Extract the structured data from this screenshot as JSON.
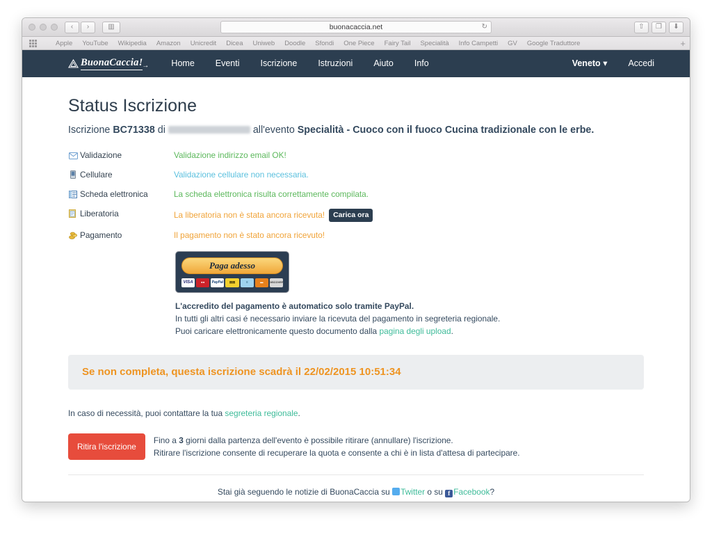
{
  "browser": {
    "url": "buonacaccia.net",
    "reload_icon": "reload-icon",
    "back_icon": "‹",
    "forward_icon": "›",
    "sidebar_icon": "▥",
    "share_icon": "⇧",
    "tabs_icon": "❐",
    "download_icon": "⬇",
    "add_bookmark": "+",
    "bookmarks": [
      "Apple",
      "YouTube",
      "Wikipedia",
      "Amazon",
      "Unicredit",
      "Dicea",
      "Uniweb",
      "Doodle",
      "Sfondi",
      "One Piece",
      "Fairy Tail",
      "Specialità",
      "Info Campetti",
      "GV",
      "Google Traduttore"
    ]
  },
  "site": {
    "logo_text": "BuonaCaccia!",
    "nav": [
      "Home",
      "Eventi",
      "Iscrizione",
      "Istruzioni",
      "Aiuto",
      "Info"
    ],
    "region_selector": "Veneto",
    "region_caret": "▾",
    "login": "Accedi"
  },
  "page": {
    "title": "Status Iscrizione",
    "lead": {
      "prefix": "Iscrizione ",
      "code": "BC71338",
      "of": " di ",
      "name_redacted": "",
      "event_prefix": " all'evento ",
      "event": "Specialità - Cuoco con il fuoco Cucina tradizionale con le erbe."
    },
    "status_rows": [
      {
        "icon": "envelope-icon",
        "label": "Validazione",
        "message": "Validazione indirizzo email OK!",
        "state": "ok"
      },
      {
        "icon": "mobile-phone-icon",
        "label": "Cellulare",
        "message": "Validazione cellulare non necessaria.",
        "state": "info"
      },
      {
        "icon": "form-card-icon",
        "label": "Scheda elettronica",
        "message": "La scheda elettronica risulta correttamente compilata.",
        "state": "ok"
      },
      {
        "icon": "document-icon",
        "label": "Liberatoria",
        "message": "La liberatoria non è stata ancora ricevuta!",
        "state": "warn",
        "action_label": "Carica ora"
      },
      {
        "icon": "coins-icon",
        "label": "Pagamento",
        "message": "Il pagamento non è stato ancora ricevuto!",
        "state": "warn"
      }
    ],
    "paypal": {
      "button_label": "Paga adesso",
      "cards": [
        "VISA",
        "MC",
        "PayPal",
        "JCB",
        "AE",
        "AMEX",
        "DISCOVER"
      ]
    },
    "payment_note": {
      "line1": "L'accredito del pagamento è automatico solo tramite PayPal.",
      "line2": "In tutti gli altri casi é necessario inviare la ricevuta del pagamento in segreteria regionale.",
      "line3_prefix": "Puoi caricare elettronicamente questo documento dalla ",
      "line3_link": "pagina degli upload",
      "line3_suffix": "."
    },
    "expiry_alert": "Se non completa, questa iscrizione scadrà il 22/02/2015 10:51:34",
    "contact": {
      "prefix": "In caso di necessità, puoi contattare la tua ",
      "link": "segreteria regionale",
      "suffix": "."
    },
    "withdraw": {
      "button_label": "Ritira l'iscrizione",
      "line1_prefix": "Fino a ",
      "line1_days": "3",
      "line1_suffix": " giorni dalla partenza dell'evento è possibile ritirare (annullare) l'iscrizione.",
      "line2": "Ritirare l'iscrizione consente di recuperare la quota e consente a chi è in lista d'attesa di partecipare."
    },
    "social": {
      "prefix": "Stai già seguendo le notizie di BuonaCaccia su ",
      "twitter": "Twitter",
      "middle": " o su ",
      "facebook": "Facebook",
      "suffix": "?",
      "fb_glyph": "f"
    }
  }
}
